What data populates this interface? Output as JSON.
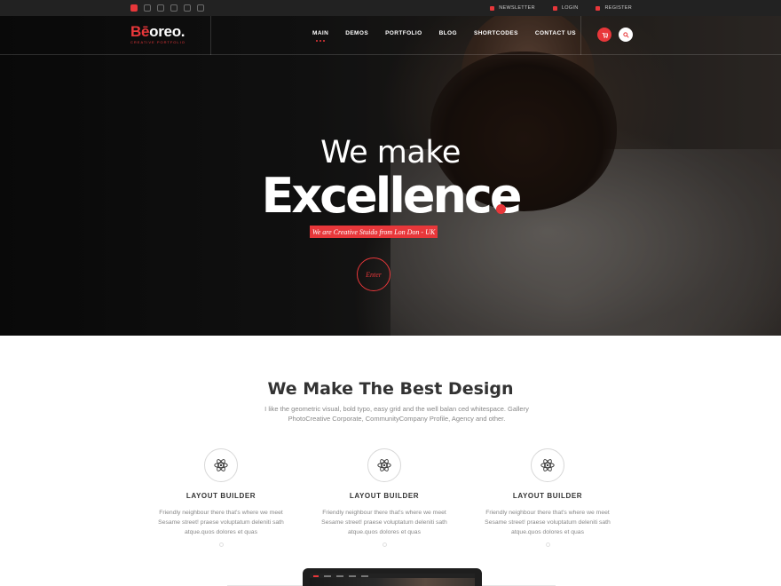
{
  "topbar": {
    "social_icons": [
      "instagram-icon",
      "twitter-icon",
      "pinterest-icon",
      "instagram-outline-icon",
      "skype-icon",
      "dribbble-icon"
    ],
    "links": [
      {
        "label": "NEWSLETTER",
        "icon": "envelope-icon"
      },
      {
        "label": "LOGIN",
        "icon": "key-icon"
      },
      {
        "label": "REGISTER",
        "icon": "user-icon"
      }
    ]
  },
  "logo": {
    "brand_first": "Bē",
    "brand_rest": "oreo.",
    "tagline": "CREATIVE PORTFOLIO"
  },
  "nav": {
    "items": [
      "MAIN",
      "DEMOS",
      "PORTFOLIO",
      "BLOG",
      "SHORTCODES",
      "CONTACT US"
    ],
    "active": "MAIN",
    "cart_icon": "cart-icon",
    "search_icon": "search-icon"
  },
  "hero": {
    "line1": "We make",
    "line2": "Excellence",
    "tagline": "We are Creative Stuido from Lon Don - UK",
    "enter_label": "Enter"
  },
  "section": {
    "title": "We Make The Best Design",
    "description": "I like the geometric visual, bold typo, easy grid and the well balan ced whitespace. Gallery PhotoCreative Corporate, CommunityCompany Profile, Agency and other."
  },
  "features": [
    {
      "icon": "atom-icon",
      "title": "LAYOUT BUILDER",
      "text": "Friendly neighbour there that's where we meet Sesame street! praese voluptatum deleniti sath atque.quos dolores et quas"
    },
    {
      "icon": "atom-icon",
      "title": "LAYOUT BUILDER",
      "text": "Friendly neighbour there that's where we meet Sesame street! praese voluptatum deleniti sath atque.quos dolores et quas"
    },
    {
      "icon": "atom-icon",
      "title": "LAYOUT BUILDER",
      "text": "Friendly neighbour there that's where we meet Sesame street! praese voluptatum deleniti sath atque.quos dolores et quas"
    }
  ],
  "colors": {
    "accent": "#e8373a",
    "topbar_bg": "#222222",
    "heading": "#333333",
    "body_text": "#888888"
  }
}
